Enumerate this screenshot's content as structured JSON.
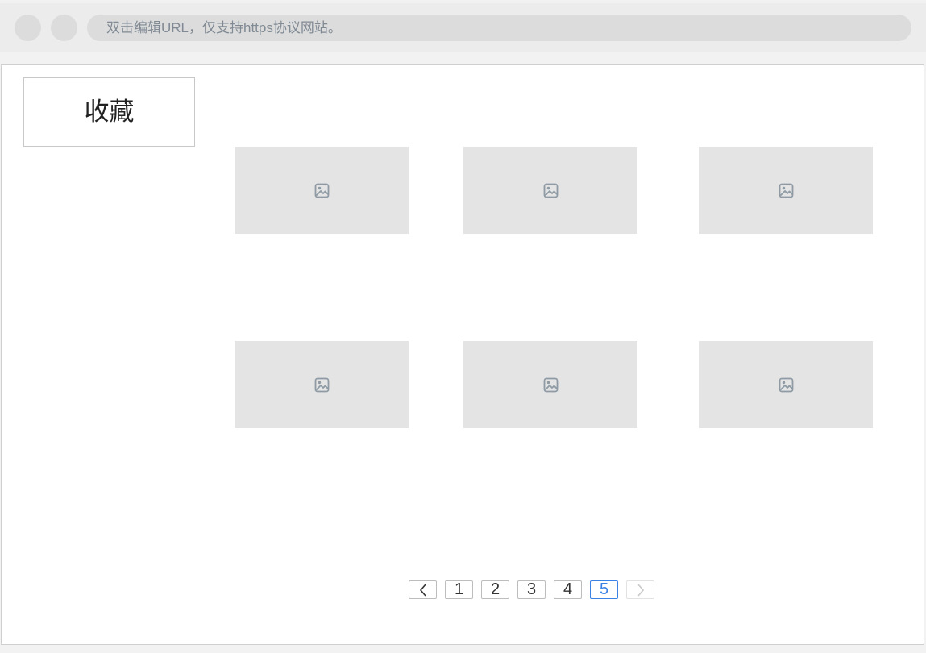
{
  "browser": {
    "url_placeholder": "双击编辑URL，仅支持https协议网站。"
  },
  "sidebar": {
    "favorites_label": "收藏"
  },
  "gallery": {
    "items": [
      {
        "icon": "image-icon"
      },
      {
        "icon": "image-icon"
      },
      {
        "icon": "image-icon"
      },
      {
        "icon": "image-icon"
      },
      {
        "icon": "image-icon"
      },
      {
        "icon": "image-icon"
      }
    ]
  },
  "pagination": {
    "prev_icon": "chevron-left-icon",
    "next_icon": "chevron-right-icon",
    "pages": [
      "1",
      "2",
      "3",
      "4",
      "5"
    ],
    "current_page": "5",
    "next_disabled": true
  },
  "colors": {
    "active_page": "#3b82e6",
    "placeholder_bg": "#e4e4e4",
    "icon": "#8e9aa4"
  }
}
